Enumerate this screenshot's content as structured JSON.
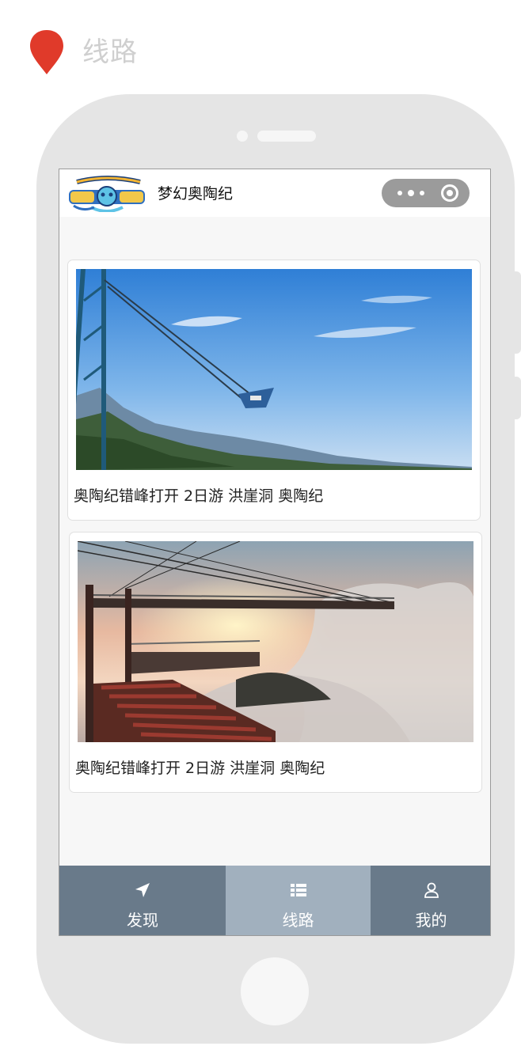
{
  "page": {
    "title": "线路",
    "accent_color": "#e03a2a"
  },
  "miniprogram": {
    "name": "梦幻奥陶纪",
    "logo_icon": "dream-ordovician-logo"
  },
  "routes": [
    {
      "caption": "奥陶纪错峰打开  2日游  洪崖洞  奥陶纪",
      "image": "giant-swing-over-cliff-photo"
    },
    {
      "caption": "奥陶纪错峰打开  2日游  洪崖洞  奥陶纪",
      "image": "glass-skywalk-sunset-photo"
    }
  ],
  "tabbar": {
    "background": "#697a8a",
    "active_background": "#a1b0be",
    "items": [
      {
        "label": "发现",
        "icon": "location-arrow-icon",
        "active": false
      },
      {
        "label": "线路",
        "icon": "list-icon",
        "active": true
      },
      {
        "label": "我的",
        "icon": "user-icon",
        "active": false
      }
    ]
  }
}
